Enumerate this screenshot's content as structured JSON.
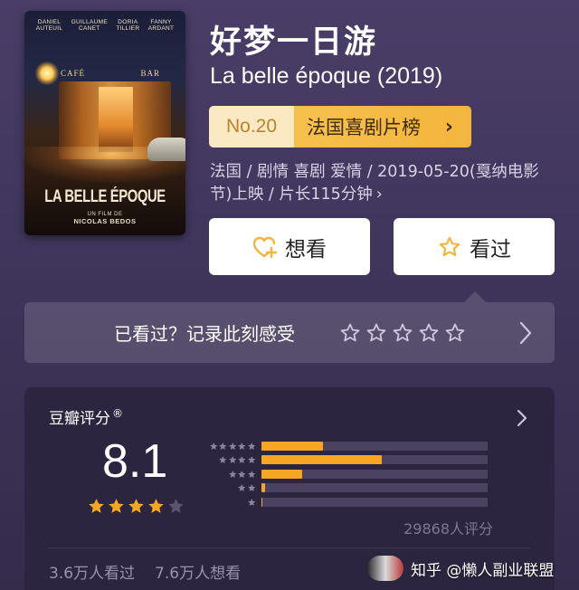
{
  "poster": {
    "actors": [
      {
        "first": "DANIEL",
        "last": "AUTEUIL"
      },
      {
        "first": "GUILLAUME",
        "last": "CANET"
      },
      {
        "first": "DORIA",
        "last": "TILLIER"
      },
      {
        "first": "FANNY",
        "last": "ARDANT"
      }
    ],
    "sign_left": "CAFÉ",
    "sign_right": "BAR",
    "title": "LA BELLE ÉPOQUE",
    "director_prefix": "UN FILM DE",
    "director": "NICOLAS BEDOS"
  },
  "movie": {
    "title_cn": "好梦一日游",
    "title_original": "La belle époque (2019)"
  },
  "ranking": {
    "number": "No.20",
    "list_name": "法国喜剧片榜",
    "chevron": "›"
  },
  "meta": {
    "text": "法国 / 剧情 喜剧 爱情 / 2019-05-20(戛纳电影节)上映 / 片长115分钟",
    "chevron": "›"
  },
  "actions": {
    "want_label": "想看",
    "seen_label": "看过",
    "want_icon": "heart-plus-icon",
    "seen_icon": "star-outline-icon"
  },
  "rate_prompt": {
    "text": "已看过？记录此刻感受",
    "star_count": 5
  },
  "rating": {
    "label": "豆瓣评分",
    "registered": "®",
    "score": "8.1",
    "stars_value": 4,
    "distribution": [
      {
        "stars": 5,
        "percent": 27
      },
      {
        "stars": 4,
        "percent": 53
      },
      {
        "stars": 3,
        "percent": 18
      },
      {
        "stars": 2,
        "percent": 1.5
      },
      {
        "stars": 1,
        "percent": 0.5
      }
    ],
    "count_text": "29868人评分",
    "seen_count": "3.6万人看过",
    "want_count": "7.6万人想看"
  },
  "colors": {
    "accent": "#f6a623",
    "rank_light": "#fbe9c3",
    "rank_gold": "#f3b53d",
    "background": "#3d3358"
  },
  "watermark": {
    "text": "知乎 @懒人副业联盟"
  }
}
